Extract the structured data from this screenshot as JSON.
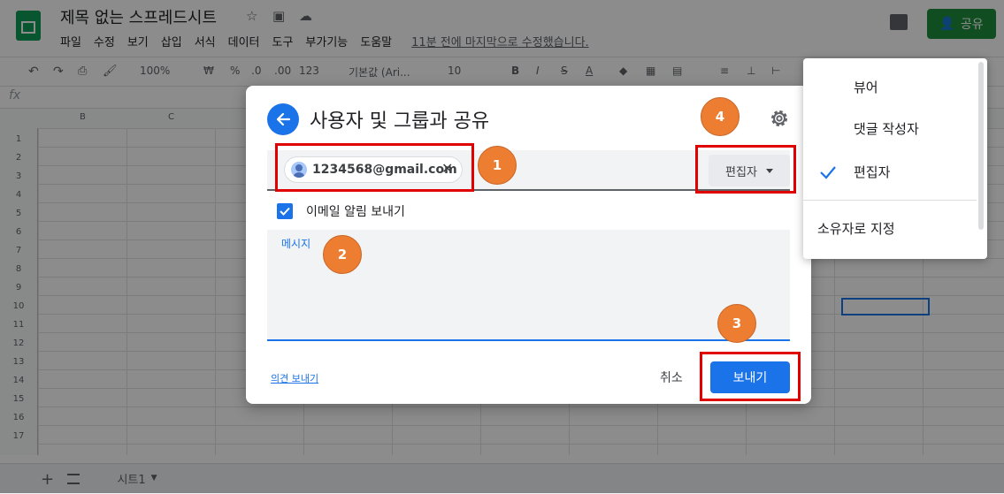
{
  "app": {
    "doc_title": "제목 없는 스프레드시트",
    "menu": [
      "파일",
      "수정",
      "보기",
      "삽입",
      "서식",
      "데이터",
      "도구",
      "부가기능",
      "도움말"
    ],
    "last_edit": "11분 전에 마지막으로 수정했습니다.",
    "share_label": "공유",
    "toolbar": {
      "zoom": "100%",
      "currency": "₩",
      "percent": "%",
      "dec_decrease": ".0",
      "dec_increase": ".00",
      "format": "123",
      "font": "기본값 (Ari...",
      "font_size": "10",
      "bold": "B",
      "italic": "I",
      "strike": "S",
      "text_color": "A"
    },
    "columns": [
      "B",
      "C"
    ],
    "rows": [
      "1",
      "2",
      "3",
      "4",
      "5",
      "6",
      "7",
      "8",
      "9",
      "10",
      "11",
      "12",
      "13",
      "14",
      "15",
      "16",
      "17"
    ],
    "sheet_tab": "시트1"
  },
  "dialog": {
    "title": "사용자 및 그룹과 공유",
    "recipient_email": "1234568@gmail.com",
    "role_selected": "편집자",
    "notify_label": "이메일 알림 보내기",
    "notify_checked": true,
    "message_placeholder": "메시지",
    "feedback_link": "의견 보내기",
    "cancel_label": "취소",
    "send_label": "보내기"
  },
  "role_menu": {
    "items": [
      "뷰어",
      "댓글 작성자",
      "편집자"
    ],
    "selected": "편집자",
    "owner_option": "소유자로 지정"
  },
  "annotations": [
    "1",
    "2",
    "3",
    "4"
  ],
  "colors": {
    "accent": "#1a73e8",
    "share_green": "#1e8e3e",
    "annotation_red": "#e00000",
    "step_orange": "#ed7d31"
  }
}
